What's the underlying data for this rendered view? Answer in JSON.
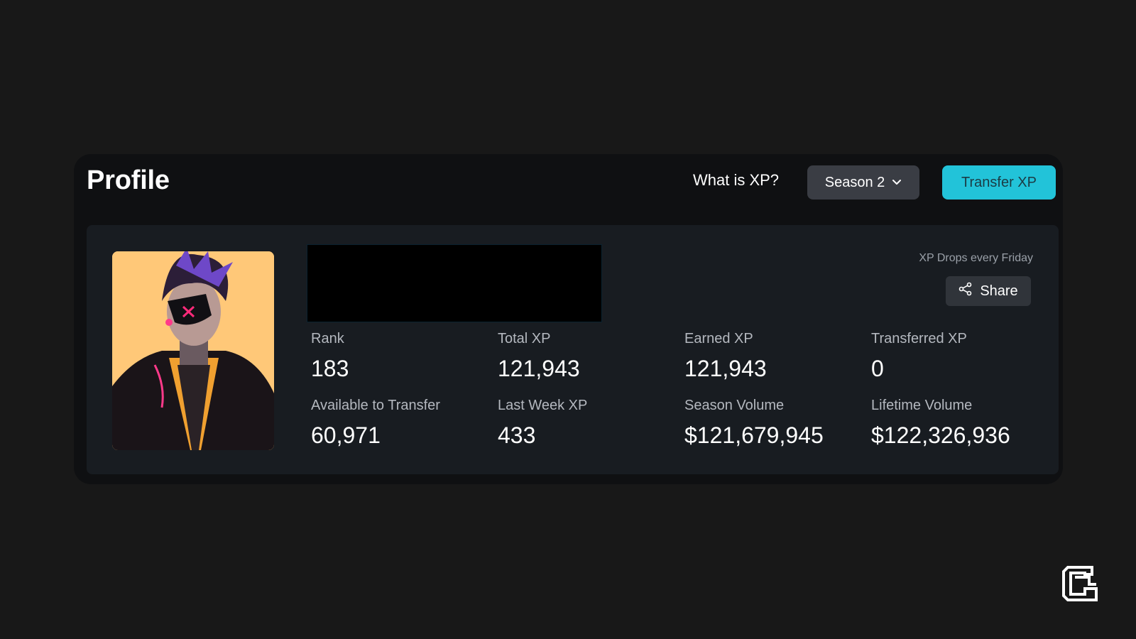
{
  "header": {
    "title": "Profile",
    "what_is_xp": "What is XP?",
    "season_select": {
      "selected": "Season 2"
    },
    "transfer_button": "Transfer XP"
  },
  "card": {
    "drops_note": "XP Drops every Friday",
    "share_button": "Share",
    "stats": [
      {
        "label": "Rank",
        "value": "183"
      },
      {
        "label": "Total XP",
        "value": "121,943"
      },
      {
        "label": "Earned XP",
        "value": "121,943"
      },
      {
        "label": "Transferred XP",
        "value": "0"
      },
      {
        "label": "Available to Transfer",
        "value": "60,971"
      },
      {
        "label": "Last Week XP",
        "value": "433"
      },
      {
        "label": "Season Volume",
        "value": "$121,679,945"
      },
      {
        "label": "Lifetime Volume",
        "value": "$122,326,936"
      }
    ]
  },
  "icons": {
    "season_chevron": "chevron-down-icon",
    "share": "share-icon",
    "corner_logo": "brand-logo-icon"
  },
  "colors": {
    "background": "#181818",
    "panel": "#0f1012",
    "card": "#181c21",
    "accent": "#22c3d9",
    "secondary_button": "#3a3d44",
    "avatar_bg": "#ffc878"
  }
}
